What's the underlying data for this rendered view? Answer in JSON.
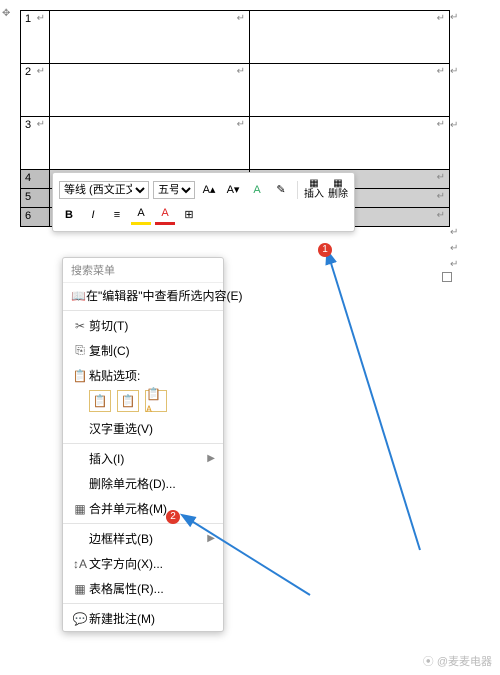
{
  "anchor_glyph": "✥",
  "para_glyph": "↵",
  "rows": {
    "r1": "1",
    "r2": "2",
    "r3": "3",
    "r4": "4",
    "r5": "5",
    "r6": "6"
  },
  "toolbar": {
    "font_name": "等线 (西文正文)",
    "font_size": "五号",
    "grow": "A▴",
    "shrink": "A▾",
    "phonetic": "A",
    "brush": "✎",
    "bold": "B",
    "italic": "I",
    "align": "≡",
    "highlight": "A",
    "fontcolor": "A",
    "border": "⊞",
    "insert_icon": "▦",
    "insert_label": "插入",
    "delete_icon": "▦",
    "delete_label": "删除"
  },
  "menu": {
    "search": "搜索菜单",
    "lookup": "在\"编辑器\"中查看所选内容(E)",
    "cut": "剪切(T)",
    "copy": "复制(C)",
    "paste_label": "粘贴选项:",
    "ime": "汉字重选(V)",
    "insert": "插入(I)",
    "delete_cells": "删除单元格(D)...",
    "merge": "合并单元格(M)",
    "border_style": "边框样式(B)",
    "text_dir": "文字方向(X)...",
    "table_props": "表格属性(R)...",
    "new_comment": "新建批注(M)"
  },
  "badges": {
    "one": "1",
    "two": "2"
  },
  "icons": {
    "lookup": "📖",
    "cut": "✂",
    "copy": "⎘",
    "paste": "📋",
    "paste1": "📋",
    "paste2": "📋",
    "paste3": "📋ᴀ",
    "merge": "▦",
    "textdir": "↕A",
    "tprops": "▦",
    "comment": "💬"
  },
  "watermark": "⦿ @麦麦电器"
}
